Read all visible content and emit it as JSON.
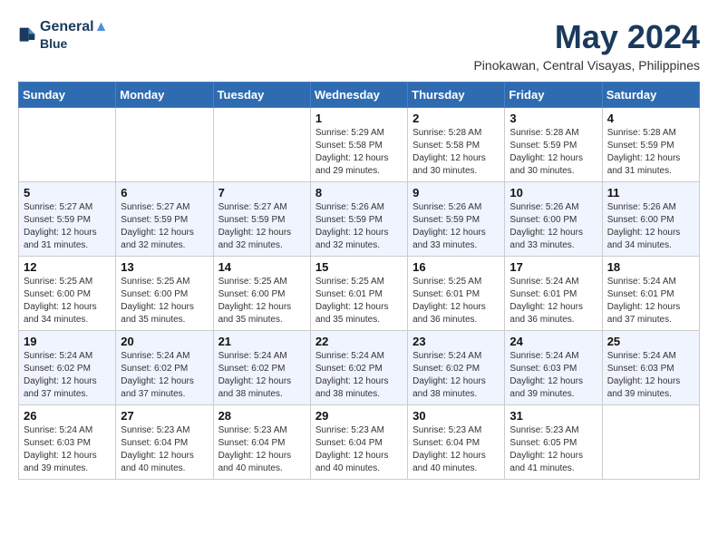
{
  "header": {
    "logo_line1": "General",
    "logo_line2": "Blue",
    "month": "May 2024",
    "location": "Pinokawan, Central Visayas, Philippines"
  },
  "days_of_week": [
    "Sunday",
    "Monday",
    "Tuesday",
    "Wednesday",
    "Thursday",
    "Friday",
    "Saturday"
  ],
  "weeks": [
    [
      {
        "day": "",
        "sunrise": "",
        "sunset": "",
        "daylight": ""
      },
      {
        "day": "",
        "sunrise": "",
        "sunset": "",
        "daylight": ""
      },
      {
        "day": "",
        "sunrise": "",
        "sunset": "",
        "daylight": ""
      },
      {
        "day": "1",
        "sunrise": "Sunrise: 5:29 AM",
        "sunset": "Sunset: 5:58 PM",
        "daylight": "Daylight: 12 hours and 29 minutes."
      },
      {
        "day": "2",
        "sunrise": "Sunrise: 5:28 AM",
        "sunset": "Sunset: 5:58 PM",
        "daylight": "Daylight: 12 hours and 30 minutes."
      },
      {
        "day": "3",
        "sunrise": "Sunrise: 5:28 AM",
        "sunset": "Sunset: 5:59 PM",
        "daylight": "Daylight: 12 hours and 30 minutes."
      },
      {
        "day": "4",
        "sunrise": "Sunrise: 5:28 AM",
        "sunset": "Sunset: 5:59 PM",
        "daylight": "Daylight: 12 hours and 31 minutes."
      }
    ],
    [
      {
        "day": "5",
        "sunrise": "Sunrise: 5:27 AM",
        "sunset": "Sunset: 5:59 PM",
        "daylight": "Daylight: 12 hours and 31 minutes."
      },
      {
        "day": "6",
        "sunrise": "Sunrise: 5:27 AM",
        "sunset": "Sunset: 5:59 PM",
        "daylight": "Daylight: 12 hours and 32 minutes."
      },
      {
        "day": "7",
        "sunrise": "Sunrise: 5:27 AM",
        "sunset": "Sunset: 5:59 PM",
        "daylight": "Daylight: 12 hours and 32 minutes."
      },
      {
        "day": "8",
        "sunrise": "Sunrise: 5:26 AM",
        "sunset": "Sunset: 5:59 PM",
        "daylight": "Daylight: 12 hours and 32 minutes."
      },
      {
        "day": "9",
        "sunrise": "Sunrise: 5:26 AM",
        "sunset": "Sunset: 5:59 PM",
        "daylight": "Daylight: 12 hours and 33 minutes."
      },
      {
        "day": "10",
        "sunrise": "Sunrise: 5:26 AM",
        "sunset": "Sunset: 6:00 PM",
        "daylight": "Daylight: 12 hours and 33 minutes."
      },
      {
        "day": "11",
        "sunrise": "Sunrise: 5:26 AM",
        "sunset": "Sunset: 6:00 PM",
        "daylight": "Daylight: 12 hours and 34 minutes."
      }
    ],
    [
      {
        "day": "12",
        "sunrise": "Sunrise: 5:25 AM",
        "sunset": "Sunset: 6:00 PM",
        "daylight": "Daylight: 12 hours and 34 minutes."
      },
      {
        "day": "13",
        "sunrise": "Sunrise: 5:25 AM",
        "sunset": "Sunset: 6:00 PM",
        "daylight": "Daylight: 12 hours and 35 minutes."
      },
      {
        "day": "14",
        "sunrise": "Sunrise: 5:25 AM",
        "sunset": "Sunset: 6:00 PM",
        "daylight": "Daylight: 12 hours and 35 minutes."
      },
      {
        "day": "15",
        "sunrise": "Sunrise: 5:25 AM",
        "sunset": "Sunset: 6:01 PM",
        "daylight": "Daylight: 12 hours and 35 minutes."
      },
      {
        "day": "16",
        "sunrise": "Sunrise: 5:25 AM",
        "sunset": "Sunset: 6:01 PM",
        "daylight": "Daylight: 12 hours and 36 minutes."
      },
      {
        "day": "17",
        "sunrise": "Sunrise: 5:24 AM",
        "sunset": "Sunset: 6:01 PM",
        "daylight": "Daylight: 12 hours and 36 minutes."
      },
      {
        "day": "18",
        "sunrise": "Sunrise: 5:24 AM",
        "sunset": "Sunset: 6:01 PM",
        "daylight": "Daylight: 12 hours and 37 minutes."
      }
    ],
    [
      {
        "day": "19",
        "sunrise": "Sunrise: 5:24 AM",
        "sunset": "Sunset: 6:02 PM",
        "daylight": "Daylight: 12 hours and 37 minutes."
      },
      {
        "day": "20",
        "sunrise": "Sunrise: 5:24 AM",
        "sunset": "Sunset: 6:02 PM",
        "daylight": "Daylight: 12 hours and 37 minutes."
      },
      {
        "day": "21",
        "sunrise": "Sunrise: 5:24 AM",
        "sunset": "Sunset: 6:02 PM",
        "daylight": "Daylight: 12 hours and 38 minutes."
      },
      {
        "day": "22",
        "sunrise": "Sunrise: 5:24 AM",
        "sunset": "Sunset: 6:02 PM",
        "daylight": "Daylight: 12 hours and 38 minutes."
      },
      {
        "day": "23",
        "sunrise": "Sunrise: 5:24 AM",
        "sunset": "Sunset: 6:02 PM",
        "daylight": "Daylight: 12 hours and 38 minutes."
      },
      {
        "day": "24",
        "sunrise": "Sunrise: 5:24 AM",
        "sunset": "Sunset: 6:03 PM",
        "daylight": "Daylight: 12 hours and 39 minutes."
      },
      {
        "day": "25",
        "sunrise": "Sunrise: 5:24 AM",
        "sunset": "Sunset: 6:03 PM",
        "daylight": "Daylight: 12 hours and 39 minutes."
      }
    ],
    [
      {
        "day": "26",
        "sunrise": "Sunrise: 5:24 AM",
        "sunset": "Sunset: 6:03 PM",
        "daylight": "Daylight: 12 hours and 39 minutes."
      },
      {
        "day": "27",
        "sunrise": "Sunrise: 5:23 AM",
        "sunset": "Sunset: 6:04 PM",
        "daylight": "Daylight: 12 hours and 40 minutes."
      },
      {
        "day": "28",
        "sunrise": "Sunrise: 5:23 AM",
        "sunset": "Sunset: 6:04 PM",
        "daylight": "Daylight: 12 hours and 40 minutes."
      },
      {
        "day": "29",
        "sunrise": "Sunrise: 5:23 AM",
        "sunset": "Sunset: 6:04 PM",
        "daylight": "Daylight: 12 hours and 40 minutes."
      },
      {
        "day": "30",
        "sunrise": "Sunrise: 5:23 AM",
        "sunset": "Sunset: 6:04 PM",
        "daylight": "Daylight: 12 hours and 40 minutes."
      },
      {
        "day": "31",
        "sunrise": "Sunrise: 5:23 AM",
        "sunset": "Sunset: 6:05 PM",
        "daylight": "Daylight: 12 hours and 41 minutes."
      },
      {
        "day": "",
        "sunrise": "",
        "sunset": "",
        "daylight": ""
      }
    ]
  ]
}
